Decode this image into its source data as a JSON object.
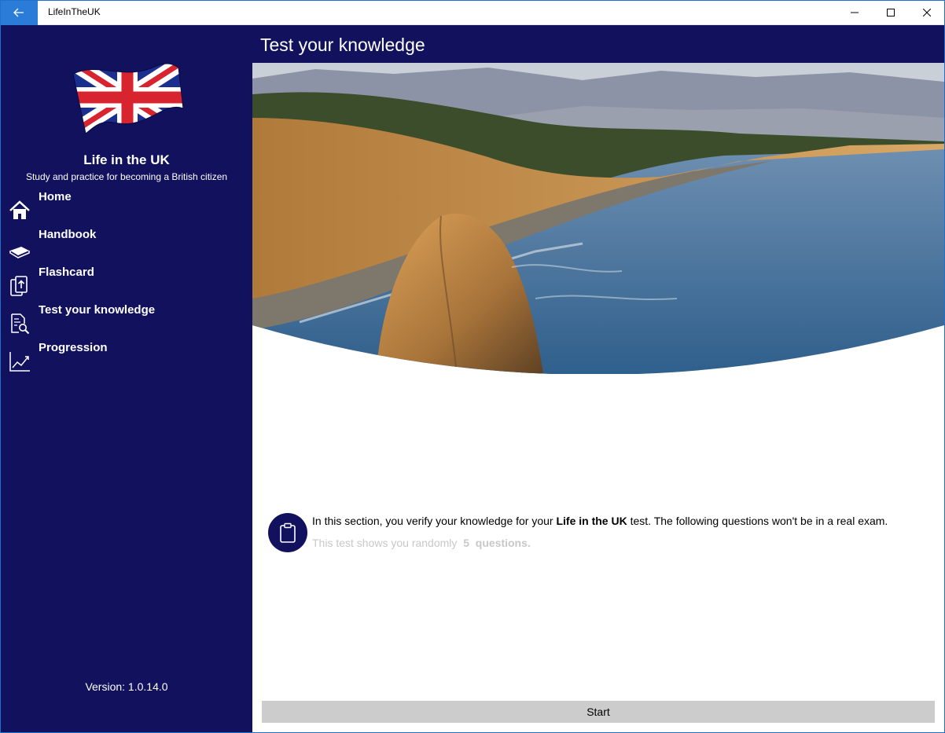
{
  "window": {
    "title": "LifeInTheUK"
  },
  "sidebar": {
    "app_name": "Life in the UK",
    "tagline": "Study and practice for becoming a British citizen",
    "items": [
      {
        "label": "Home",
        "icon": "home-icon"
      },
      {
        "label": "Handbook",
        "icon": "book-icon"
      },
      {
        "label": "Flashcard",
        "icon": "flashcard-icon"
      },
      {
        "label": "Test your knowledge",
        "icon": "test-document-search-icon"
      },
      {
        "label": "Progression",
        "icon": "line-chart-icon"
      }
    ],
    "version": "Version: 1.0.14.0"
  },
  "main": {
    "title": "Test your knowledge",
    "info": {
      "text_before": "In this section, you verify your knowledge for your ",
      "text_bold": "Life in the UK",
      "text_after": " test. The following questions won't be in a real exam.",
      "sub_before": "This test shows you randomly",
      "question_count": "5",
      "sub_after": "questions."
    },
    "start_label": "Start"
  },
  "colors": {
    "navy": "#11115e",
    "accent_blue": "#2b7bd8",
    "button_gray": "#cccccc"
  }
}
